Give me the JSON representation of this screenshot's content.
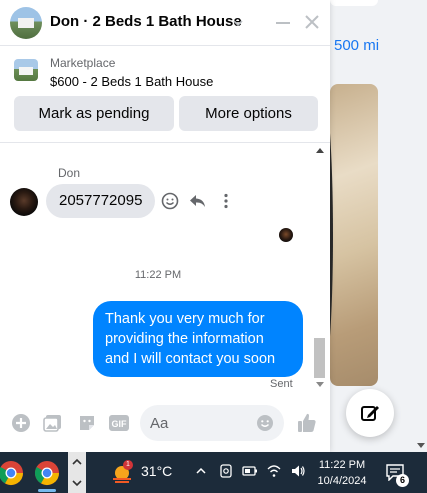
{
  "background": {
    "distance_text": "500 mi"
  },
  "chat": {
    "header": {
      "title": "Don · 2 Beds 1 Bath House"
    },
    "listing": {
      "label": "Marketplace",
      "title": "$600 - 2 Beds 1 Bath House"
    },
    "actions": {
      "pending_label": "Mark as pending",
      "more_label": "More options"
    },
    "messages": {
      "sender_name": "Don",
      "incoming_text": "2057772095",
      "timestamp": "11:22 PM",
      "outgoing_text": "Thank you very much for providing the information and I will contact you soon",
      "status": "Sent"
    },
    "composer": {
      "placeholder": "Aa"
    }
  },
  "colors": {
    "accent": "#0084ff",
    "bubble_in": "#e4e6eb",
    "taskbar": "#1c2b3a"
  },
  "taskbar": {
    "weather_badge": "1",
    "temperature": "31°C",
    "time": "11:22 PM",
    "date": "10/4/2024",
    "notification_count": "6"
  }
}
